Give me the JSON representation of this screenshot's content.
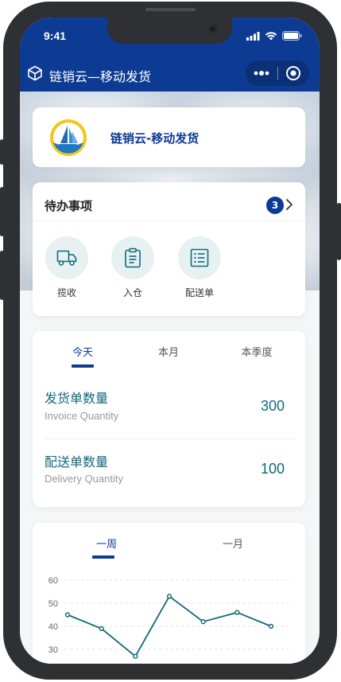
{
  "status_bar": {
    "time": "9:41"
  },
  "nav": {
    "title": "链销云—移动发货"
  },
  "brand": {
    "name": "链销云-移动发货"
  },
  "todo": {
    "title": "待办事项",
    "badge_count": "3",
    "items": [
      {
        "label": "揽收",
        "icon": "truck-icon"
      },
      {
        "label": "入仓",
        "icon": "clipboard-icon"
      },
      {
        "label": "配送单",
        "icon": "list-icon"
      }
    ]
  },
  "stats": {
    "tabs": [
      "今天",
      "本月",
      "本季度"
    ],
    "active_tab": "今天",
    "rows": [
      {
        "title": "发货单数量",
        "subtitle": "Invoice Quantity",
        "value": "300"
      },
      {
        "title": "配送单数量",
        "subtitle": "Delivery Quantity",
        "value": "100"
      }
    ]
  },
  "trend": {
    "tabs": [
      "一周",
      "一月"
    ],
    "active_tab": "一周"
  },
  "chart_data": {
    "type": "line",
    "x": [
      1,
      2,
      3,
      4,
      5,
      6,
      7
    ],
    "values": [
      45,
      39,
      27,
      53,
      42,
      46,
      40
    ],
    "yticks": [
      "60",
      "50",
      "40",
      "30"
    ],
    "ylim": [
      30,
      60
    ],
    "grid": true,
    "color": "#0f6a7a"
  },
  "colors": {
    "brand": "#0d3b93",
    "accent": "#0f6a7a",
    "icon_bg": "#e8f1f2"
  }
}
